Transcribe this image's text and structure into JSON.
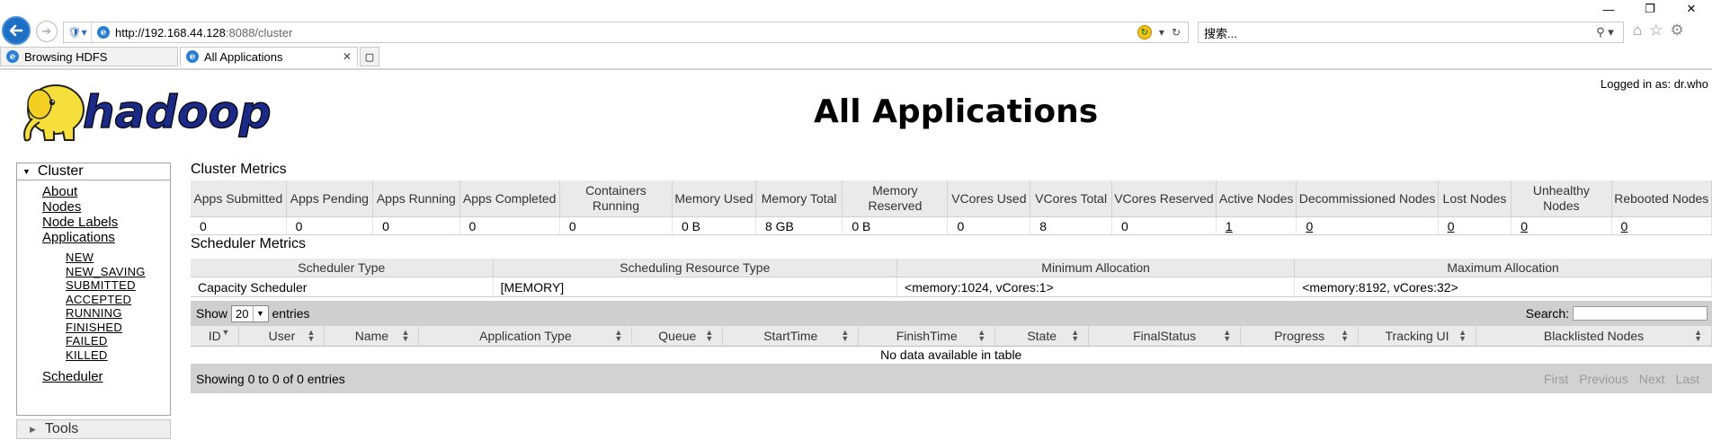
{
  "browser": {
    "url_host": "http://192.168.44.128",
    "url_rest": ":8088/cluster",
    "search_placeholder": "搜索...",
    "tabs": [
      {
        "label": "Browsing HDFS",
        "active": false
      },
      {
        "label": "All Applications",
        "active": true
      }
    ],
    "window_controls": [
      "—",
      "❐",
      "✕"
    ]
  },
  "header": {
    "logged_in": "Logged in as: dr.who",
    "title": "All Applications",
    "logo_text": "hadoop"
  },
  "sidebar": {
    "cluster_label": "Cluster",
    "cluster_links": [
      "About",
      "Nodes",
      "Node Labels",
      "Applications"
    ],
    "app_states": [
      "NEW",
      "NEW_SAVING",
      "SUBMITTED",
      "ACCEPTED",
      "RUNNING",
      "FINISHED",
      "FAILED",
      "KILLED"
    ],
    "scheduler_label": "Scheduler",
    "tools_label": "Tools"
  },
  "cluster_metrics": {
    "title": "Cluster Metrics",
    "headers": [
      "Apps Submitted",
      "Apps Pending",
      "Apps Running",
      "Apps Completed",
      "Containers Running",
      "Memory Used",
      "Memory Total",
      "Memory Reserved",
      "VCores Used",
      "VCores Total",
      "VCores Reserved",
      "Active Nodes",
      "Decommissioned Nodes",
      "Lost Nodes",
      "Unhealthy Nodes",
      "Rebooted Nodes"
    ],
    "values": [
      "0",
      "0",
      "0",
      "0",
      "0",
      "0 B",
      "8 GB",
      "0 B",
      "0",
      "8",
      "0",
      "1",
      "0",
      "0",
      "0",
      "0"
    ],
    "linked_from_index": 11
  },
  "scheduler_metrics": {
    "title": "Scheduler Metrics",
    "headers": [
      "Scheduler Type",
      "Scheduling Resource Type",
      "Minimum Allocation",
      "Maximum Allocation"
    ],
    "values": [
      "Capacity Scheduler",
      "[MEMORY]",
      "<memory:1024, vCores:1>",
      "<memory:8192, vCores:32>"
    ]
  },
  "apps_table": {
    "show_label": "Show",
    "entries_value": "20",
    "entries_label": "entries",
    "search_label": "Search:",
    "headers": [
      "ID",
      "User",
      "Name",
      "Application Type",
      "Queue",
      "StartTime",
      "FinishTime",
      "State",
      "FinalStatus",
      "Progress",
      "Tracking UI",
      "Blacklisted Nodes"
    ],
    "empty_message": "No data available in table",
    "info": "Showing 0 to 0 of 0 entries",
    "pager": [
      "First",
      "Previous",
      "Next",
      "Last"
    ]
  }
}
